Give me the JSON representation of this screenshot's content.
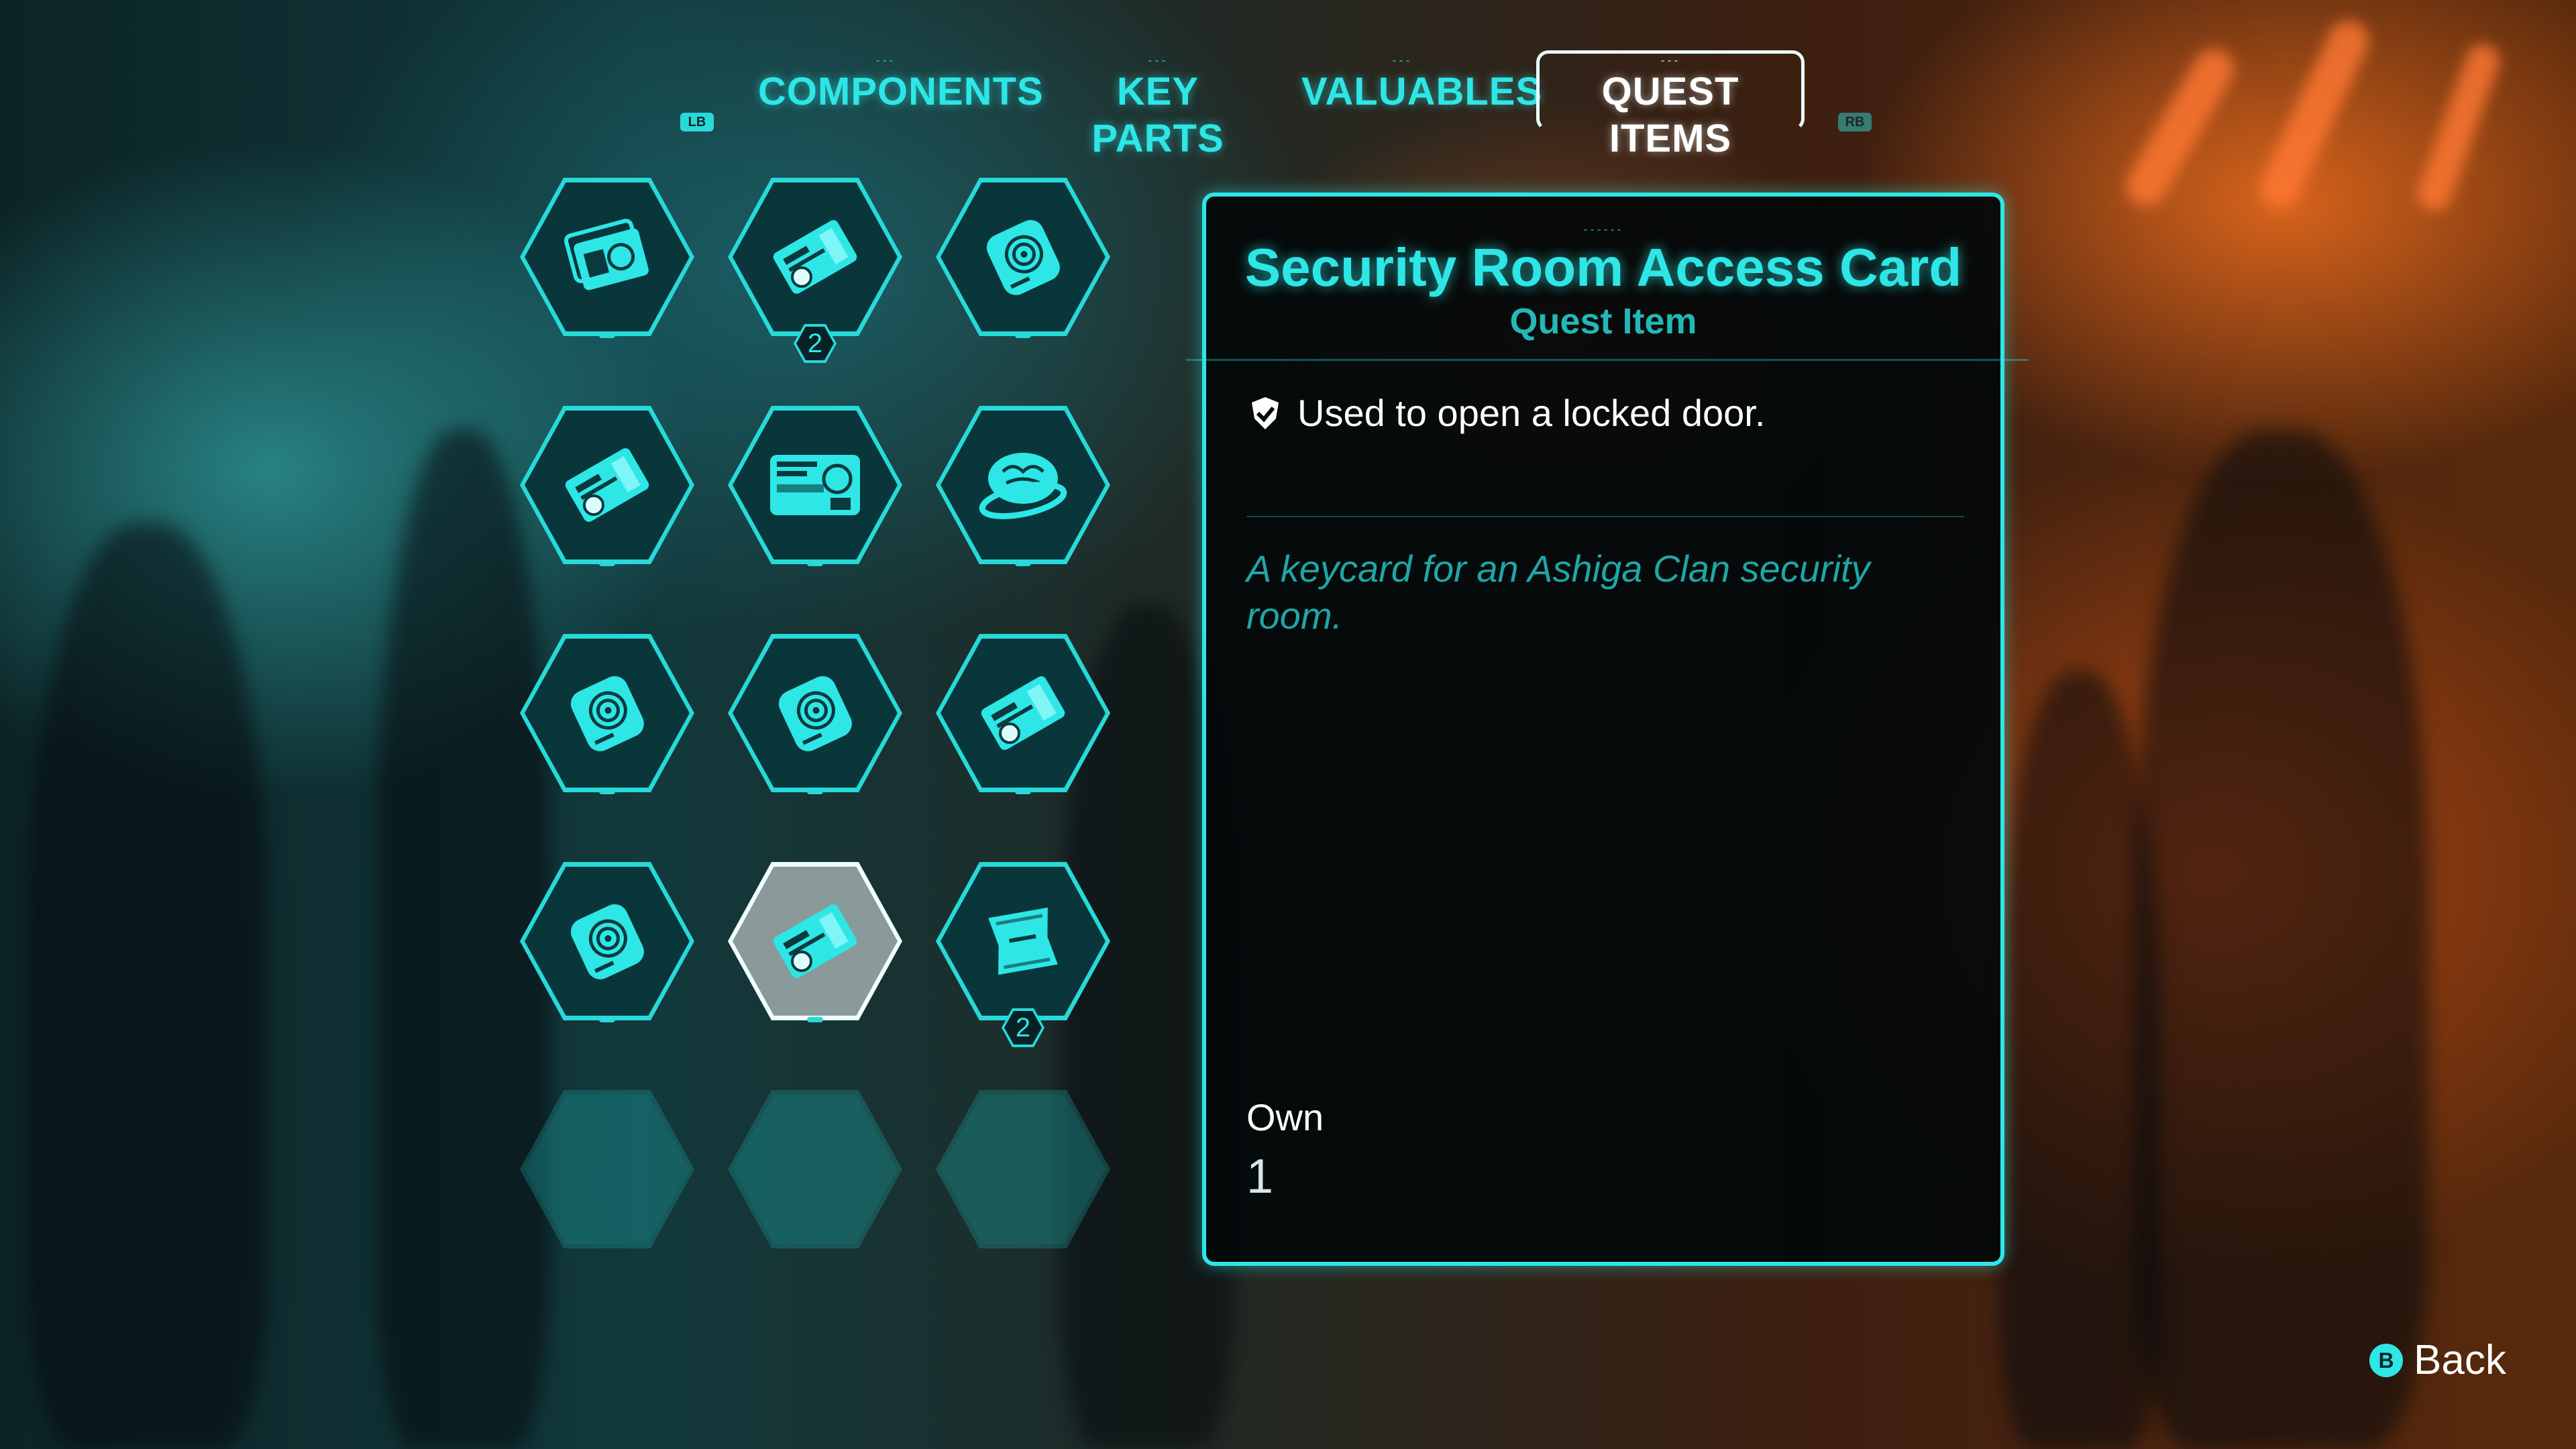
{
  "tabs": {
    "left_bumper": "LB",
    "right_bumper": "RB",
    "items": [
      {
        "label": "COMPONENTS",
        "active": false
      },
      {
        "label": "KEY PARTS",
        "active": false
      },
      {
        "label": "VALUABLES",
        "active": false
      },
      {
        "label": "QUEST ITEMS",
        "active": true
      }
    ]
  },
  "grid": {
    "items": [
      {
        "icon": "id-cards-icon",
        "count": ""
      },
      {
        "icon": "access-card-icon",
        "count": "2"
      },
      {
        "icon": "data-drive-icon",
        "count": ""
      },
      {
        "icon": "access-card-icon",
        "count": ""
      },
      {
        "icon": "id-badge-icon",
        "count": ""
      },
      {
        "icon": "brain-ring-icon",
        "count": ""
      },
      {
        "icon": "data-drive-icon",
        "count": ""
      },
      {
        "icon": "data-drive-icon",
        "count": ""
      },
      {
        "icon": "access-card-icon",
        "count": ""
      },
      {
        "icon": "data-drive-icon",
        "count": ""
      },
      {
        "icon": "access-card-icon",
        "count": "",
        "selected": true
      },
      {
        "icon": "packet-icon",
        "count": "2"
      },
      {
        "icon": "empty-slot",
        "count": ""
      },
      {
        "icon": "empty-slot",
        "count": ""
      },
      {
        "icon": "empty-slot",
        "count": ""
      }
    ]
  },
  "detail": {
    "title": "Security Room Access Card",
    "type": "Quest Item",
    "effect_icon": "shield-check-icon",
    "effect": "Used to open a locked door.",
    "description": "A keycard for an Ashiga Clan security room.",
    "own_label": "Own",
    "own_value": "1"
  },
  "back": {
    "button": "B",
    "label": "Back"
  },
  "colors": {
    "accent": "#2ee6e6",
    "panel_bg": "#03080a",
    "text": "#ffffff"
  }
}
